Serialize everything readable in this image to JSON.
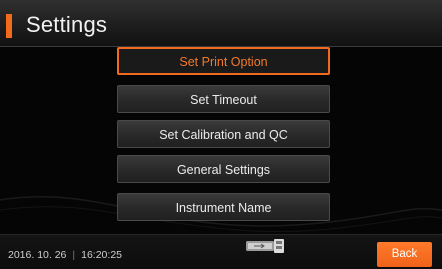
{
  "header": {
    "title": "Settings",
    "accent_color": "#f26a1b"
  },
  "menu": {
    "items": [
      {
        "label": "Set Print Option",
        "selected": true
      },
      {
        "label": "Set Timeout",
        "selected": false
      },
      {
        "label": "Set Calibration and QC",
        "selected": false
      },
      {
        "label": "General Settings",
        "selected": false
      },
      {
        "label": "Instrument Name",
        "selected": false
      }
    ],
    "selected_color": "#f06a1f"
  },
  "footer": {
    "date": "2016. 10. 26",
    "separator": "|",
    "time": "16:20:25",
    "device_icon": "usb-device-icon",
    "back_label": "Back",
    "back_color": "#f26a1b"
  }
}
